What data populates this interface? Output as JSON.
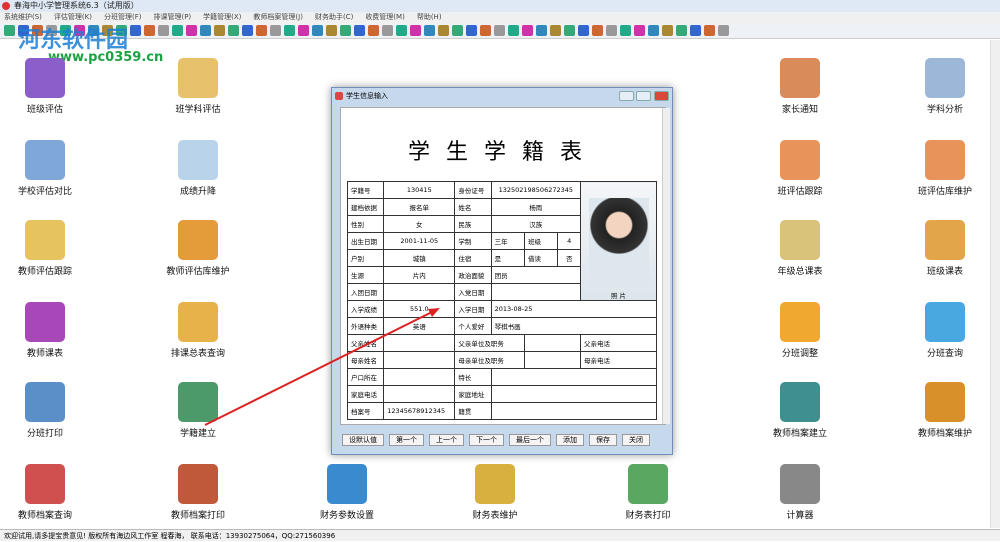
{
  "window_title": "春海中小学管理系统6.3（试用版）",
  "menu": [
    "系统维护(S)",
    "评估管理(K)",
    "分班管理(F)",
    "排课管理(P)",
    "学籍管理(X)",
    "教师档案管理(J)",
    "财务助手(C)",
    "收费管理(M)",
    "帮助(H)"
  ],
  "watermark": "河东软件园",
  "watermark_url": "www.pc0359.cn",
  "desktop": [
    {
      "label": "班级评估",
      "color": "#8a5fc9"
    },
    {
      "label": "班学科评估",
      "color": "#e8c26a"
    },
    {
      "label": "家长通知",
      "color": "#d98b5a"
    },
    {
      "label": "学科分析",
      "color": "#9cb7d8"
    },
    {
      "label": "学校评估对比",
      "color": "#7fa7d8"
    },
    {
      "label": "成绩升降",
      "color": "#b9d3ea"
    },
    {
      "label": "班评估跟踪",
      "color": "#e8935a"
    },
    {
      "label": "班评估库维护",
      "color": "#e8935a"
    },
    {
      "label": "教师评估跟踪",
      "color": "#e6c35f"
    },
    {
      "label": "教师评估库维护",
      "color": "#e49b3a"
    },
    {
      "label": "年级总课表",
      "color": "#d9c27a"
    },
    {
      "label": "班级课表",
      "color": "#e2a54a"
    },
    {
      "label": "教师课表",
      "color": "#a848b8"
    },
    {
      "label": "排课总表查询",
      "color": "#e8b24a"
    },
    {
      "label": "分班调整",
      "color": "#f0a830"
    },
    {
      "label": "分班查询",
      "color": "#4aa8e0"
    },
    {
      "label": "分班打印",
      "color": "#5b8fc8"
    },
    {
      "label": "学籍建立",
      "color": "#4c9a6a"
    },
    {
      "label": "教师档案建立",
      "color": "#3f8f8f"
    },
    {
      "label": "教师档案维护",
      "color": "#d8902a"
    },
    {
      "label": "教师档案查询",
      "color": "#d05050"
    },
    {
      "label": "教师档案打印",
      "color": "#c0583a"
    },
    {
      "label": "财务参数设置",
      "color": "#3a8ad0"
    },
    {
      "label": "财务表维护",
      "color": "#d8b040"
    },
    {
      "label": "财务表打印",
      "color": "#5aa860"
    },
    {
      "label": "计算器",
      "color": "#888888"
    }
  ],
  "dialog": {
    "title": "学生信息输入",
    "heading": "学生学籍表",
    "fields": {
      "id_label": "学籍号",
      "id": "130415",
      "idcard_label": "身份证号",
      "idcard": "132502198506272345",
      "basis_label": "建档依据",
      "basis": "报名单",
      "name_label": "姓名",
      "name": "杨雨",
      "gender_label": "性别",
      "gender": "女",
      "ethnic_label": "民族",
      "ethnic": "汉族",
      "birth_label": "出生日期",
      "birth": "2001-11-05",
      "system_label": "学制",
      "system": "三年",
      "class_label": "班级",
      "class": "4",
      "hukou_label": "户别",
      "hukou": "城镇",
      "board_label": "住宿",
      "board": "是",
      "transfer_label": "借读",
      "transfer": "否",
      "source_label": "生源",
      "source": "片内",
      "political_label": "政治面貌",
      "political": "团员",
      "league_label": "入团日期",
      "party_label": "入党日期",
      "photo_label": "照 片",
      "score_label": "入学成绩",
      "score": "551.0",
      "enroll_label": "入学日期",
      "enroll": "2013-08-25",
      "lang_label": "外语种类",
      "lang": "英语",
      "hobby_label": "个人爱好",
      "hobby": "琴棋书画",
      "father_label": "父亲姓名",
      "father_work_label": "父亲单位及职务",
      "father_tel_label": "父亲电话",
      "mother_label": "母亲姓名",
      "mother_work_label": "母亲单位及职务",
      "mother_tel_label": "母亲电话",
      "residence_label": "户口所在",
      "talent_label": "特长",
      "home_tel_label": "家庭电话",
      "address_label": "家庭地址",
      "file_label": "档案号",
      "file": "12345678912345",
      "native_label": "籍贯"
    },
    "buttons": [
      "设默认值",
      "第一个",
      "上一个",
      "下一个",
      "最后一个",
      "添加",
      "保存",
      "关闭"
    ]
  },
  "status": "欢迎试用,请多提宝贵意见!   版权所有海边风工作室 程春海， 联系电话：13930275064，QQ:271560396"
}
